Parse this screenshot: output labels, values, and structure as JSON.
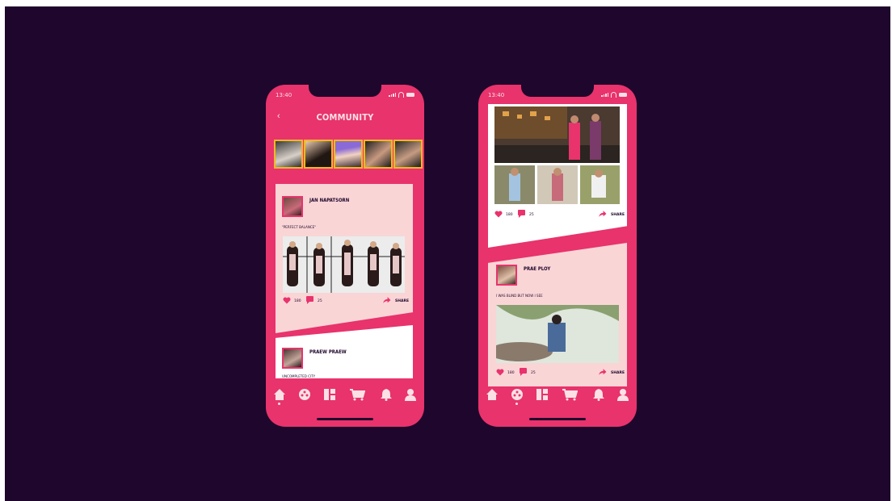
{
  "colors": {
    "background": "#1f062c",
    "accent": "#e8336c",
    "card": "#fad5d6",
    "story_border": "#f1b820",
    "nav_icon": "#fbe1e6"
  },
  "left_phone": {
    "status_time": "13:40",
    "header": {
      "title": "COMMUNITY",
      "back_icon": "chevron-left-icon"
    },
    "stories": [
      "story-1",
      "story-2",
      "story-3",
      "story-4",
      "story-5"
    ],
    "posts": [
      {
        "username": "JAN NAPATSORN",
        "caption": "\"PERFECT BALANCE\"",
        "likes": "180",
        "comments": "25",
        "share_label": "SHARE"
      },
      {
        "username": "PRAEW PRAEW",
        "caption": "UNCOMPLETED CITY"
      }
    ],
    "nav": [
      "home-icon",
      "community-icon",
      "grid-icon",
      "cart-icon",
      "bell-icon",
      "profile-icon"
    ],
    "active_nav": "home-icon"
  },
  "right_phone": {
    "status_time": "13:40",
    "posts": [
      {
        "likes": "180",
        "comments": "25",
        "share_label": "SHARE"
      },
      {
        "username": "PRAE PLOY",
        "caption": "I WAS BLIND BUT NOW I SEE",
        "likes": "180",
        "comments": "25",
        "share_label": "SHARE"
      }
    ],
    "nav": [
      "home-icon",
      "community-icon",
      "grid-icon",
      "cart-icon",
      "bell-icon",
      "profile-icon"
    ],
    "active_nav": "community-icon"
  }
}
